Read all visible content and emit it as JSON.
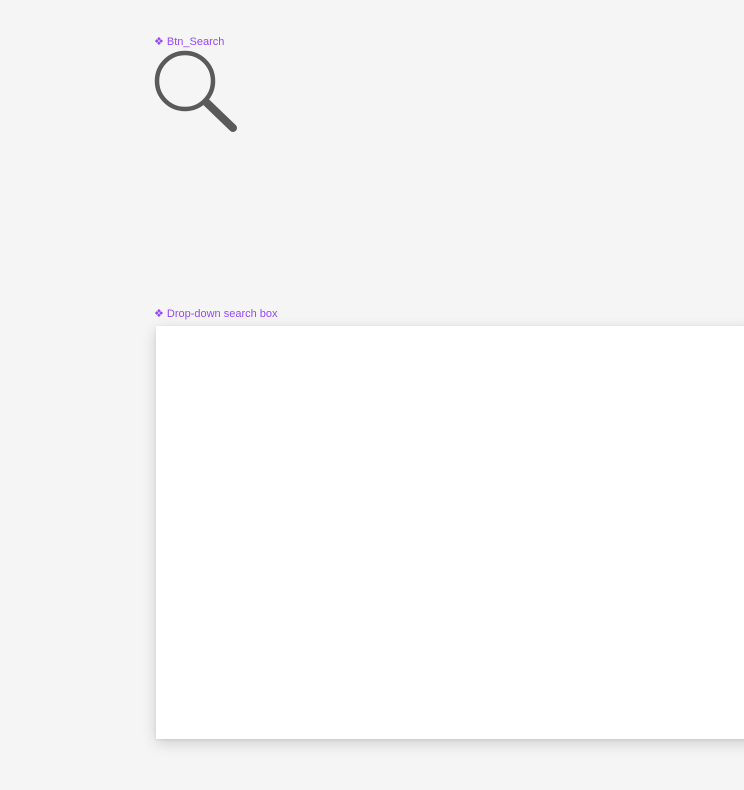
{
  "accent_color": "#9747ff",
  "icon_color": "#5a5a5a",
  "components": {
    "search_button": {
      "label": "Btn_Search",
      "icon": "search-icon",
      "label_glyph": "❖"
    },
    "dropdown_search_box": {
      "label": "Drop-down search box",
      "label_glyph": "❖"
    }
  }
}
